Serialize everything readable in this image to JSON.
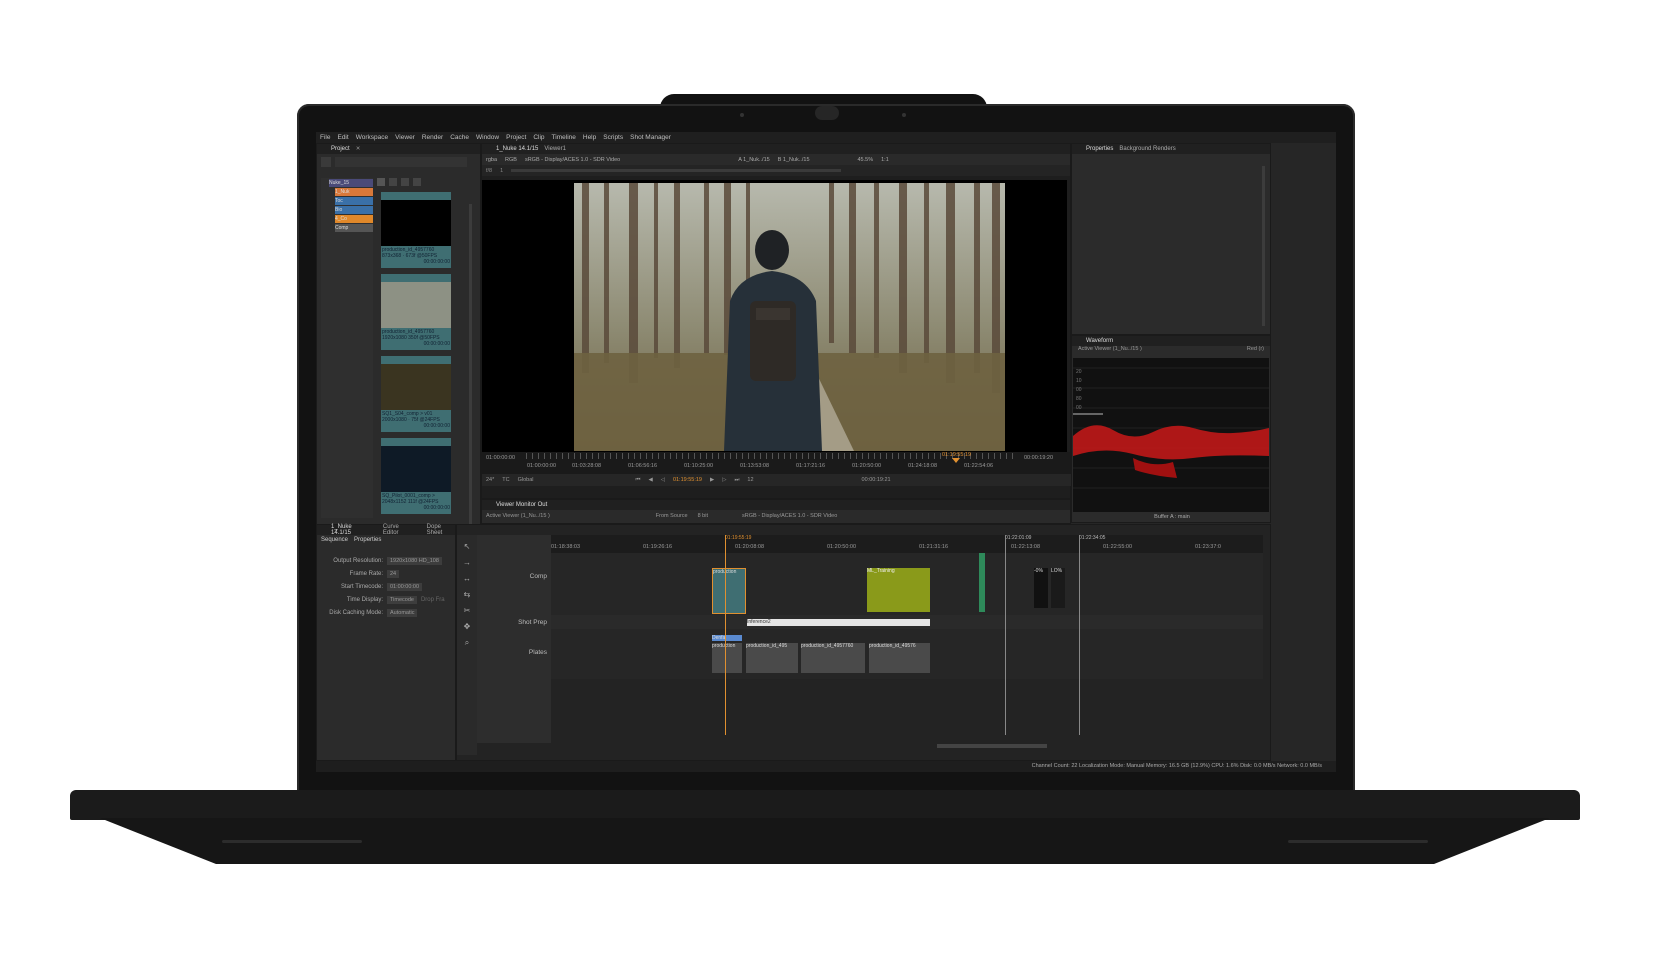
{
  "menu": [
    "File",
    "Edit",
    "Workspace",
    "Viewer",
    "Render",
    "Cache",
    "Window",
    "Project",
    "Clip",
    "Timeline",
    "Help",
    "Scripts",
    "Shot Manager"
  ],
  "project_panel": {
    "tab": "Project",
    "tree_items": [
      "Nuke_15",
      "1_Nuk",
      "Toc",
      "Bio",
      "4_Co",
      "Comp"
    ],
    "thumbnails": [
      {
        "name": "production_id_4957760",
        "meta": "873x368 · 673f @50FPS",
        "tc": "00:00:00:00"
      },
      {
        "name": "production_id_4957760",
        "meta": "1920x1080 350f @50FPS",
        "tc": "00:00:00:00"
      },
      {
        "name": "SQ1_S04_comp > v01",
        "meta": "2000x1080 · 75f @24FPS",
        "tc": "00:00:00:00"
      },
      {
        "name": "SQ_Pilot_0001_comp >",
        "meta": "2048x1152 111f @24FPS",
        "tc": "00:00:00:00"
      }
    ]
  },
  "viewer": {
    "tabs": [
      "1_Nuke 14.1/15",
      "Viewer1"
    ],
    "channels": "rgba",
    "colorspace": "RGB",
    "display": "sRGB - Display/ACES 1.0 - SDR Video",
    "input_a": "A 1_Nuk../15",
    "input_b": "B 1_Nuk../15",
    "zoom": "45.5%",
    "ratio": "1:1",
    "frame_field": "f/8",
    "frame_num": "1",
    "tc_start": "01:00:00:00",
    "tc_in": "01:00:00:00",
    "tc_marks": [
      "01:03:28:08",
      "01:06:56:16",
      "01:10:25:00",
      "01:13:53:08",
      "01:17:21:16",
      "01:20:50:00",
      "01:24:18:08",
      "01:22:54:06"
    ],
    "playhead_tc": "01:19:55:19",
    "tc_end": "00:00:19:20",
    "tc_duration": "00:00:19:21",
    "fps": "24*",
    "tc_mode": "TC",
    "scope_mode": "Global",
    "current_tc": "01:19:55:19",
    "step": "12"
  },
  "monitor_out": {
    "tab": "Viewer Monitor Out",
    "source": "Active Viewer (1_Nu../15 )",
    "from": "From Source",
    "bit": "8 bit",
    "display": "sRGB - Display/ACES 1.0 - SDR Video"
  },
  "properties": {
    "tabs": [
      "Properties",
      "Background Renders"
    ]
  },
  "waveform": {
    "tab": "Waveform",
    "source": "Active Viewer (1_Nu../15 )",
    "channel": "Red (r)",
    "buffer": "Buffer A : main",
    "scale": [
      "20",
      "10",
      "00",
      "80",
      "00"
    ]
  },
  "timeline": {
    "tabs": [
      "1_Nuke 14.1/15",
      "Curve Editor",
      "Dope Sheet"
    ],
    "sub_tabs": [
      "Sequence",
      "Properties"
    ],
    "settings": [
      {
        "label": "Output Resolution:",
        "value": "1920x1080 HD_108"
      },
      {
        "label": "Frame Rate:",
        "value": "24"
      },
      {
        "label": "Start Timecode:",
        "value": "01:00:00:00"
      },
      {
        "label": "Time Display:",
        "value": "Timecode",
        "extra": "Drop Fra"
      },
      {
        "label": "Disk Caching Mode:",
        "value": "Automatic"
      }
    ],
    "ruler": [
      "01:18:38:03",
      "01:19:26:16",
      "01:20:08:08",
      "01:20:50:00",
      "01:21:31:16",
      "01:22:13:08",
      "01:22:55:00",
      "01:23:37:0"
    ],
    "ruler_top": [
      "01:19:55:19",
      "01:22:01:09",
      "01:22:34:05"
    ],
    "tracks": [
      "Comp",
      "Shot Prep",
      "Plates"
    ],
    "clips": {
      "comp": [
        "production",
        "ML_Training",
        "-0%",
        "LO%"
      ],
      "shot_prep": "Inference2",
      "plates": [
        "Denfa",
        "production",
        "production_id_495",
        "production_id_4957760",
        "production_id_49576"
      ]
    }
  },
  "status": "Channel Count: 22  Localization Mode: Manual  Memory: 16.5 GB (12.9%)  CPU: 1.6%  Disk: 0.0 MB/s  Network: 0.0 MB/s"
}
